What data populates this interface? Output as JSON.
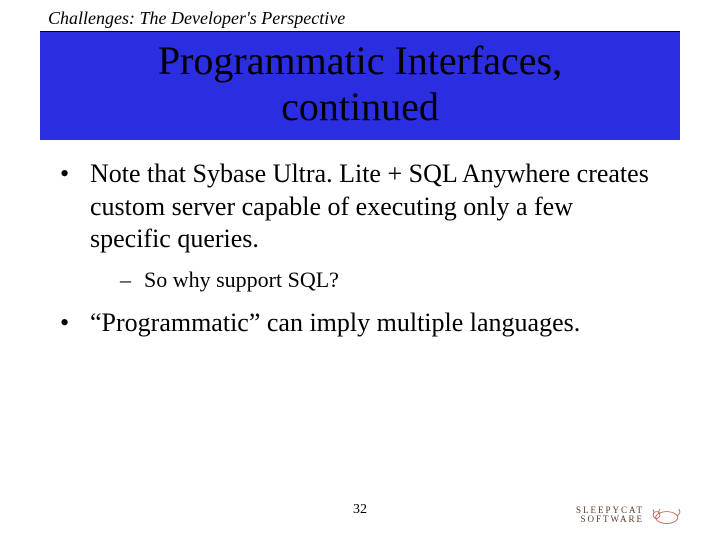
{
  "header": "Challenges: The Developer's Perspective",
  "title_line1": "Programmatic Interfaces,",
  "title_line2": "continued",
  "bullets": {
    "b1": "Note that Sybase Ultra. Lite + SQL Anywhere creates custom server capable of executing only a few specific queries.",
    "b1_sub": "So why support SQL?",
    "b2": "“Programmatic” can imply multiple languages."
  },
  "page_number": "32",
  "logo": {
    "line1": "SLEEPYCAT",
    "line2": "SOFTWARE"
  }
}
